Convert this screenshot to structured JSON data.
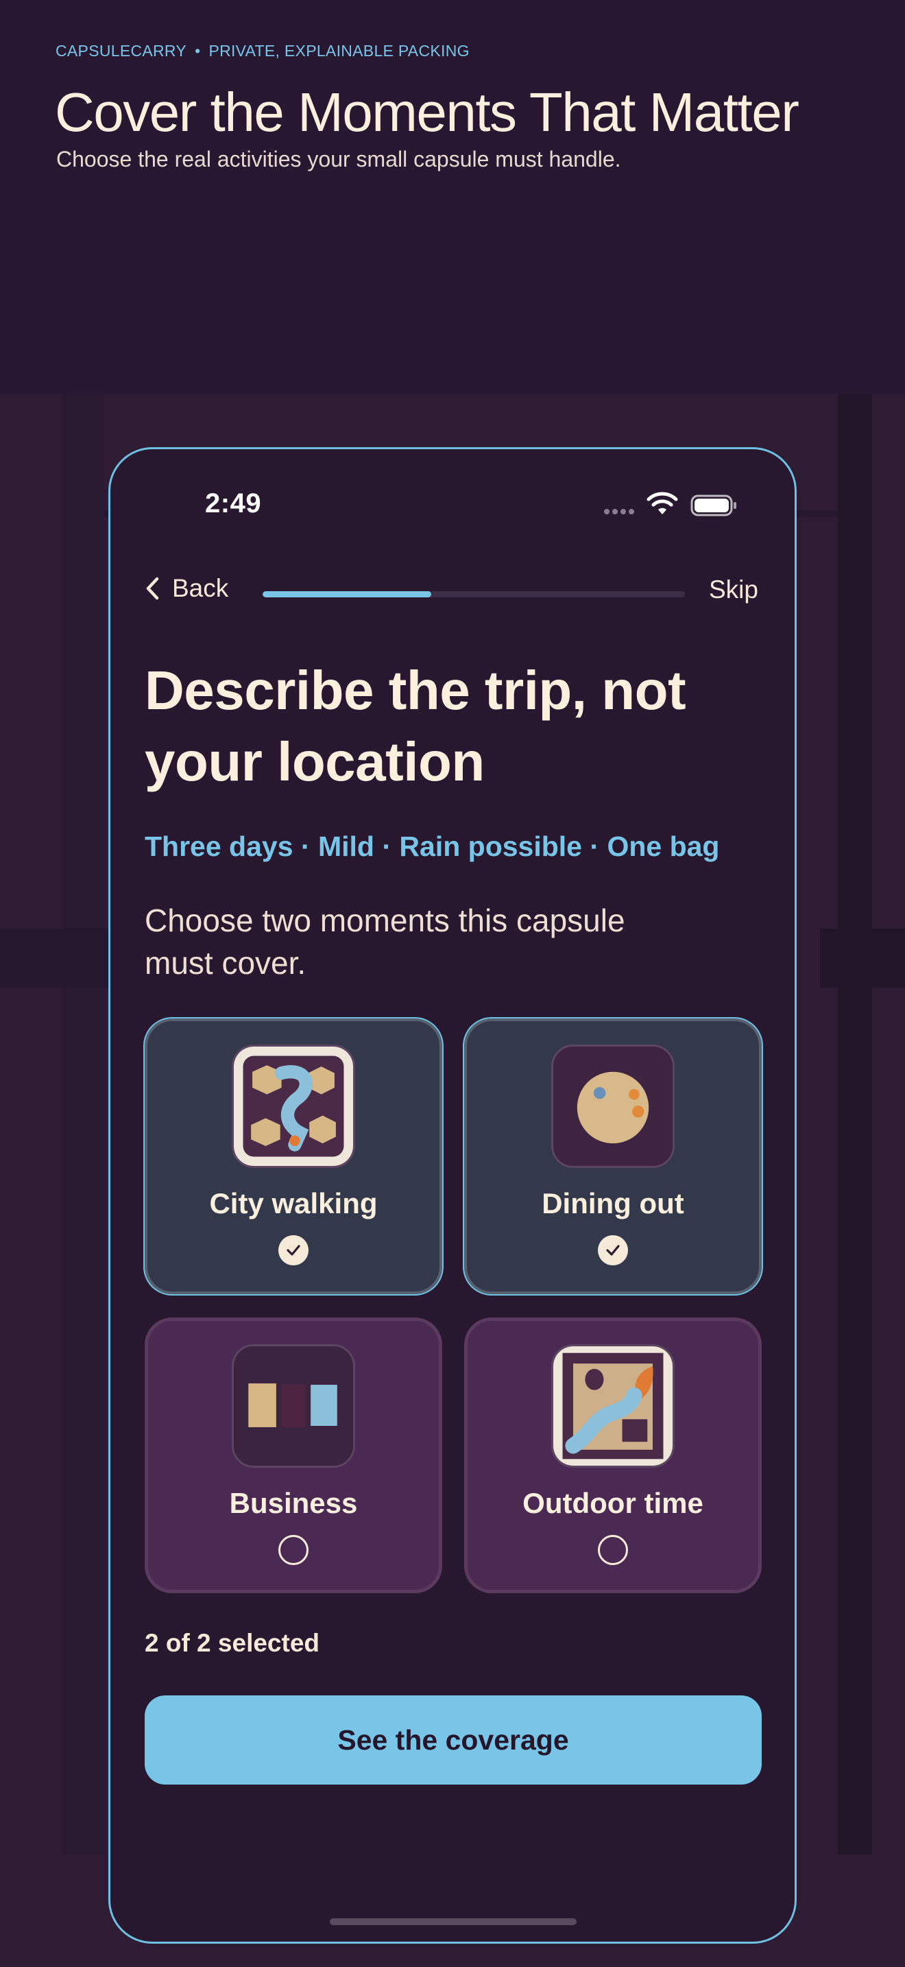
{
  "header": {
    "brand": "CAPSULECARRY",
    "tagline": "PRIVATE, EXPLAINABLE PACKING",
    "separator": "•",
    "title": "Cover the Moments That Matter",
    "subtitle": "Choose the real activities your small capsule must handle."
  },
  "status_bar": {
    "time": "2:49",
    "wifi_icon": "wifi-icon",
    "battery_icon": "battery-icon"
  },
  "nav": {
    "back_label": "Back",
    "skip_label": "Skip",
    "progress": 0.4
  },
  "screen": {
    "title": "Describe the trip, not your location",
    "trip_meta": [
      "Three days",
      "Mild",
      "Rain possible",
      "One bag"
    ],
    "trip_meta_separator": "·",
    "prompt": "Choose two moments this capsule must cover."
  },
  "activities": [
    {
      "label": "City walking",
      "selected": true,
      "icon": "city-walking-icon"
    },
    {
      "label": "Dining out",
      "selected": true,
      "icon": "dining-out-icon"
    },
    {
      "label": "Business",
      "selected": false,
      "icon": "business-icon"
    },
    {
      "label": "Outdoor time",
      "selected": false,
      "icon": "outdoor-time-icon"
    }
  ],
  "selection_count": "2 of 2 selected",
  "cta_label": "See the coverage",
  "colors": {
    "accent": "#78c5e8",
    "background": "#28182f",
    "card_selected": "#33394a",
    "card_unselected": "#4a2953",
    "text": "#fbf0de"
  }
}
